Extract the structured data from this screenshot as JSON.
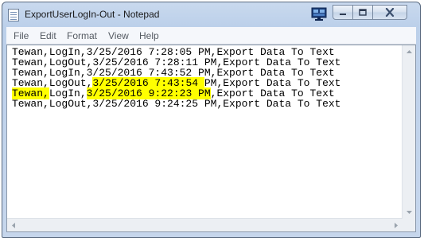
{
  "window": {
    "title": "ExportUserLogIn-Out - Notepad"
  },
  "menu": [
    "File",
    "Edit",
    "Format",
    "View",
    "Help"
  ],
  "editor": {
    "lines": [
      {
        "text": "Tewan,LogIn,3/25/2016 7:28:05 PM,Export Data To Text"
      },
      {
        "text": "Tewan,LogOut,3/25/2016 7:28:11 PM,Export Data To Text"
      },
      {
        "text": "Tewan,LogIn,3/25/2016 7:43:52 PM,Export Data To Text"
      },
      {
        "pre": "Tewan,LogOut,",
        "hl": "3/25/2016 7:43:54 ",
        "post": "PM,Export Data To Text"
      },
      {
        "hl": "Tewan,",
        "mid": "LogIn,",
        "hl2": "3/25/2016 9:22:23 PM",
        "post": ",Export Data To Text"
      },
      {
        "text": "Tewan,LogOut,3/25/2016 9:24:25 PM,Export Data To Text"
      }
    ]
  },
  "icons": {
    "app": "notepad-icon",
    "monitor": "monitor-icon",
    "minimize": "minimize-icon",
    "maximize": "maximize-icon",
    "close": "close-icon"
  },
  "colors": {
    "highlight": "#ffff00",
    "close_glyph": "#3b4f6e"
  }
}
